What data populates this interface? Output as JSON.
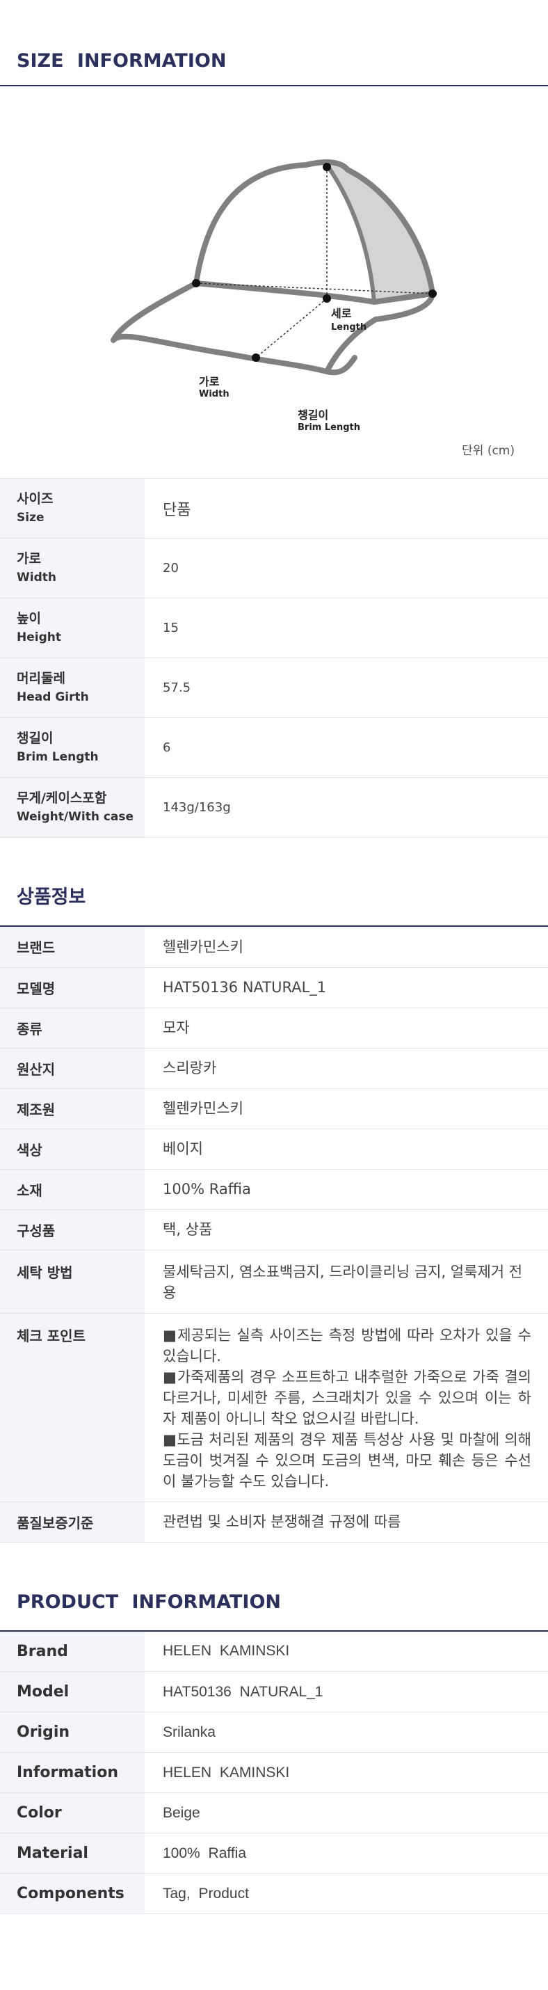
{
  "size_section": {
    "title": "SIZE INFORMATION",
    "diagram": {
      "height_label_ko": "세로",
      "height_label_en": "Length",
      "width_label_ko": "가로",
      "width_label_en": "Width",
      "brim_label_ko": "챙길이",
      "brim_label_en": "Brim Length"
    },
    "unit": "단위 (cm)",
    "rows": [
      {
        "label_ko": "사이즈",
        "label_en": "Size",
        "value": "단품"
      },
      {
        "label_ko": "가로",
        "label_en": "Width",
        "value": "20"
      },
      {
        "label_ko": "높이",
        "label_en": "Height",
        "value": "15"
      },
      {
        "label_ko": "머리둘레",
        "label_en": "Head Girth",
        "value": "57.5"
      },
      {
        "label_ko": "챙길이",
        "label_en": "Brim Length",
        "value": "6"
      },
      {
        "label_ko": "무게/케이스포함",
        "label_en": "Weight/With case",
        "value": "143g/163g"
      }
    ]
  },
  "goods_section": {
    "title": "상품정보",
    "rows": [
      {
        "label": "브랜드",
        "value": "헬렌카민스키"
      },
      {
        "label": "모델명",
        "value": "HAT50136  NATURAL_1"
      },
      {
        "label": "종류",
        "value": "모자"
      },
      {
        "label": "원산지",
        "value": "스리랑카"
      },
      {
        "label": "제조원",
        "value": "헬렌카민스키"
      },
      {
        "label": "색상",
        "value": "베이지"
      },
      {
        "label": "소재",
        "value": "100%  Raffia"
      },
      {
        "label": "구성품",
        "value": "택, 상품"
      },
      {
        "label": "세탁 방법",
        "value": "물세탁금지, 염소표백금지, 드라이클리닝 금지, 얼룩제거 전용"
      },
      {
        "label": "체크 포인트",
        "notes": [
          "■제공되는 실측 사이즈는 측정 방법에 따라 오차가 있을 수 있습니다.",
          "■가죽제품의 경우 소프트하고 내추럴한 가죽으로 가죽 결의 다르거나, 미세한 주름, 스크래치가 있을 수 있으며 이는 하자 제품이 아니니 착오 없으시길 바랍니다.",
          "■도금 처리된 제품의 경우 제품 특성상 사용 및 마찰에 의해 도금이 벗겨질 수 있으며 도금의 변색, 마모 훼손 등은 수선이 불가능할 수도 있습니다."
        ]
      },
      {
        "label": "품질보증기준",
        "value": "관련법 및 소비자 분쟁해결 규정에 따름"
      }
    ]
  },
  "product_section": {
    "title": "PRODUCT INFORMATION",
    "rows": [
      {
        "label": "Brand",
        "value": "HELEN  KAMINSKI"
      },
      {
        "label": "Model",
        "value": "HAT50136  NATURAL_1"
      },
      {
        "label": "Origin",
        "value": "Srilanka"
      },
      {
        "label": "Information",
        "value": "HELEN  KAMINSKI"
      },
      {
        "label": "Color",
        "value": "Beige"
      },
      {
        "label": "Material",
        "value": "100%  Raffia"
      },
      {
        "label": "Components",
        "value": "Tag, Product"
      }
    ]
  },
  "colors": {
    "title_navy": "#2a2f5c",
    "label_bg": "#f3f5fa",
    "diagram_stroke": "#808080",
    "diagram_fill": "#d4d4d4"
  }
}
